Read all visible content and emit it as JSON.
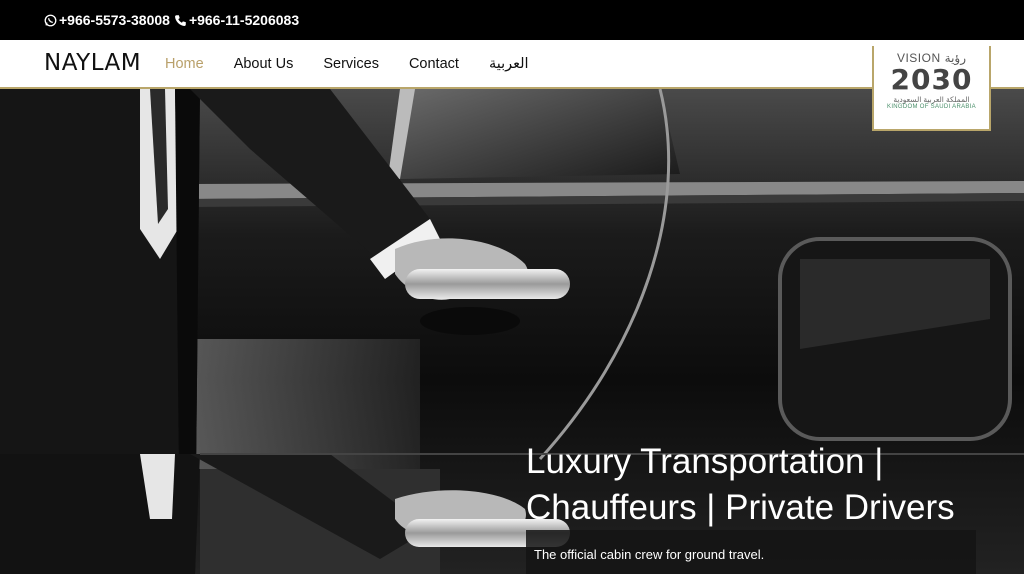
{
  "topbar": {
    "phone1": "+966-5573-38008",
    "phone1_icon": "whatsapp-icon",
    "phone2": "+966-11-5206083",
    "phone2_icon": "phone-icon"
  },
  "header": {
    "logo": "NAYLAM",
    "nav": [
      "Home",
      "About Us",
      "Services",
      "Contact",
      "العربية"
    ],
    "active": "Home",
    "accent_color": "#b9a06a"
  },
  "vision_badge": {
    "top_en": "VISION",
    "top_ar": "رؤية",
    "year": "2030",
    "arabic": "المملكة العربية السعودية",
    "english": "KINGDOM OF SAUDI ARABIA"
  },
  "hero": {
    "headline_line1": "Luxury Transportation |",
    "headline_line2": "Chauffeurs | Private Drivers",
    "subtext": "The official cabin crew for ground travel."
  }
}
